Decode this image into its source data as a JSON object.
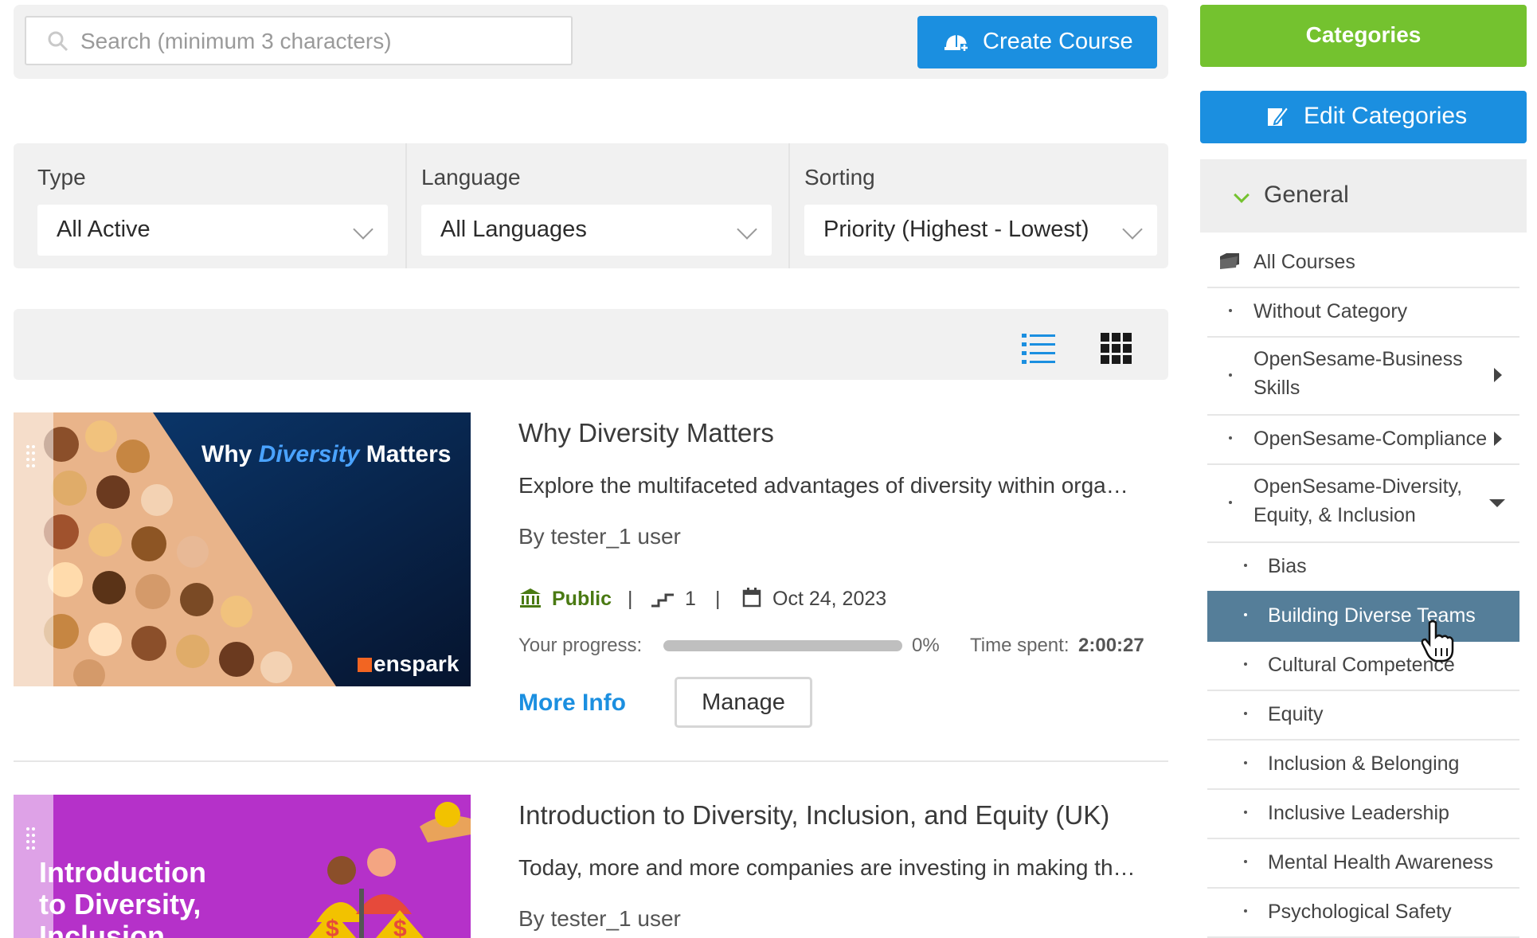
{
  "header": {
    "search_placeholder": "Search (minimum 3 characters)",
    "create_course_label": "Create Course"
  },
  "filters": {
    "type": {
      "label": "Type",
      "value": "All Active"
    },
    "language": {
      "label": "Language",
      "value": "All Languages"
    },
    "sorting": {
      "label": "Sorting",
      "value": "Priority (Highest - Lowest)"
    }
  },
  "courses": [
    {
      "thumb_title_a": "Why ",
      "thumb_title_b": "Diversity",
      "thumb_title_c": " Matters",
      "thumb_brand": "enspark",
      "title": "Why Diversity Matters",
      "description": "Explore the multifaceted advantages of diversity within orga…",
      "author": "By tester_1 user",
      "visibility": "Public",
      "sep": "|",
      "levels": "1",
      "date": "Oct 24, 2023",
      "progress_label": "Your progress:",
      "progress_value": "0%",
      "progress_fraction": 0,
      "time_label": "Time spent:",
      "time_value": "2:00:27",
      "more_info": "More Info",
      "manage": "Manage"
    },
    {
      "thumb_text_1": "Introduction",
      "thumb_text_2": "to Diversity,",
      "thumb_text_3": "Inclusion",
      "title": "Introduction to Diversity, Inclusion, and Equity (UK)",
      "description": "Today, more and more companies are investing in making th…",
      "author": "By tester_1 user"
    }
  ],
  "sidebar": {
    "categories_label": "Categories",
    "edit_categories_label": "Edit Categories",
    "general_label": "General",
    "items": [
      {
        "label": "All Courses"
      },
      {
        "label": "Without Category"
      },
      {
        "label_1": "OpenSesame-Business",
        "label_2": "Skills"
      },
      {
        "label": "OpenSesame-Compliance"
      },
      {
        "label_1": "OpenSesame-Diversity,",
        "label_2": "Equity, & Inclusion"
      },
      {
        "label": "Bias"
      },
      {
        "label": "Building Diverse Teams"
      },
      {
        "label": "Cultural Competence"
      },
      {
        "label": "Equity"
      },
      {
        "label": "Inclusion & Belonging"
      },
      {
        "label": "Inclusive Leadership"
      },
      {
        "label": "Mental Health Awareness"
      },
      {
        "label": "Psychological Safety"
      }
    ]
  },
  "colors": {
    "primary_blue": "#1b8fe0",
    "categories_green": "#74c22f",
    "active_item": "#557e99",
    "public_green": "#4a7a13"
  }
}
